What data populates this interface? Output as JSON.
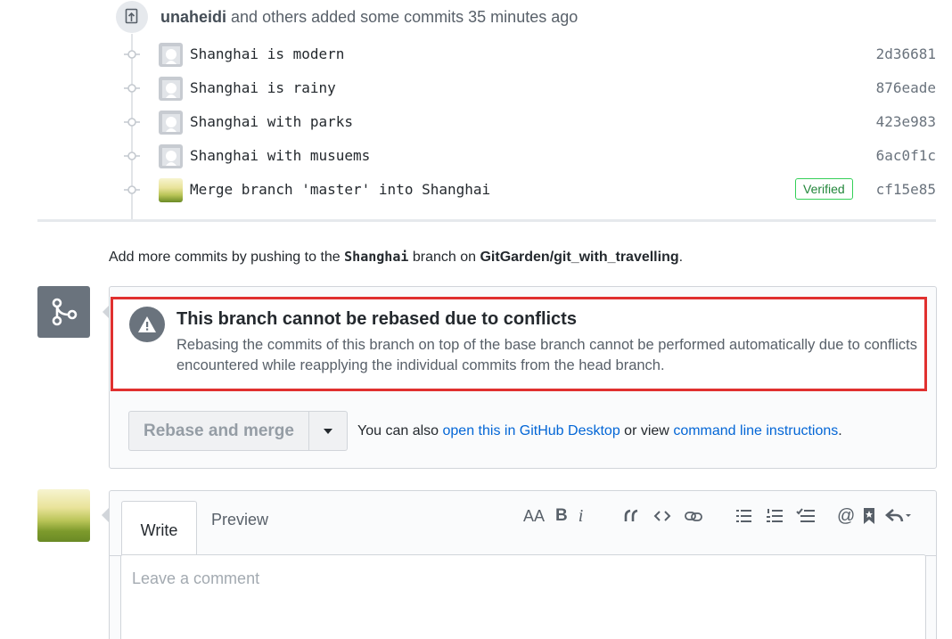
{
  "commit_group": {
    "author": "unaheidi",
    "summary": "and others added some commits 35 minutes ago"
  },
  "commits": [
    {
      "message": "Shanghai is modern",
      "sha": "2d36681",
      "verified": ""
    },
    {
      "message": "Shanghai is rainy",
      "sha": "876eade",
      "verified": ""
    },
    {
      "message": "Shanghai with parks",
      "sha": "423e983",
      "verified": ""
    },
    {
      "message": "Shanghai with musuems",
      "sha": "6ac0f1c",
      "verified": ""
    },
    {
      "message": "Merge branch 'master' into Shanghai",
      "sha": "cf15e85",
      "verified": "Verified"
    }
  ],
  "add_more": {
    "prefix": "Add more commits by pushing to the",
    "branch": "Shanghai",
    "middle": "branch on",
    "repo": "GitGarden/git_with_travelling",
    "suffix": "."
  },
  "merge_box": {
    "conflict_title": "This branch cannot be rebased due to conflicts",
    "conflict_desc": "Rebasing the commits of this branch on top of the base branch cannot be performed automatically due to conflicts encountered while reapplying the individual commits from the head branch.",
    "button_label": "Rebase and merge",
    "also_prefix": "You can also",
    "desktop_link": "open this in GitHub Desktop",
    "or_view": "or view",
    "cli_link": "command line instructions",
    "suffix": "."
  },
  "comment": {
    "tab_write": "Write",
    "tab_preview": "Preview",
    "placeholder": "Leave a comment",
    "toolbar": {
      "heading": "AA",
      "bold": "B",
      "italic": "i"
    }
  },
  "colors": {
    "link": "#0366d6",
    "conflict_border": "#e0302f",
    "verified": "#22863a"
  }
}
